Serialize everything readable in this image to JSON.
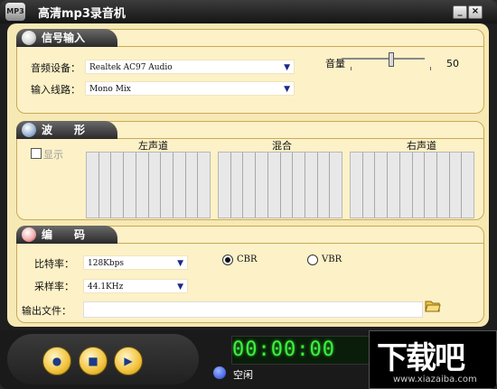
{
  "window": {
    "title": "高清mp3录音机",
    "icon_label": "MP3",
    "minimize": "_",
    "close": "×"
  },
  "input_panel": {
    "header": "信号输入",
    "audio_device_label": "音频设备：",
    "audio_device_value": "Realtek AC97 Audio",
    "input_line_label": "输入线路：",
    "input_line_value": "Mono Mix",
    "volume_label": "音量",
    "volume_value": "50"
  },
  "wave_panel": {
    "header": "波　　形",
    "show_label": "显示",
    "left_label": "左声道",
    "mix_label": "混合",
    "right_label": "右声道"
  },
  "encode_panel": {
    "header": "编　　码",
    "bitrate_label": "比特率：",
    "bitrate_value": "128Kbps",
    "samplerate_label": "采样率：",
    "samplerate_value": "44.1KHz",
    "cbr_label": "CBR",
    "vbr_label": "VBR",
    "selected_mode": "CBR",
    "output_label": "输出文件：",
    "output_value": ""
  },
  "transport": {
    "record": "●",
    "stop": "■",
    "play": "▶"
  },
  "lcd": {
    "time": "00:00:00"
  },
  "status": {
    "text": "空闲"
  },
  "watermark": {
    "big": "下载吧",
    "small": "www.xiazaiba.com"
  }
}
